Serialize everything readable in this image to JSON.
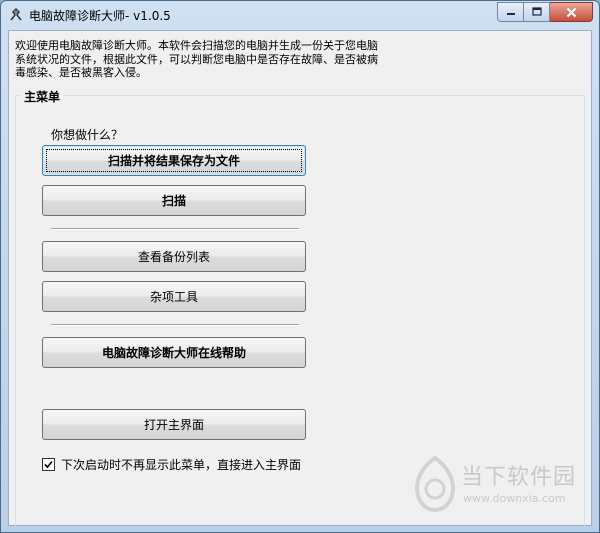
{
  "window": {
    "title": "电脑故障诊断大师- v1.0.5",
    "controls": {
      "minimize": "minimize",
      "maximize": "maximize",
      "close": "close"
    }
  },
  "intro": {
    "text": "欢迎使用电脑故障诊断大师。本软件会扫描您的电脑并生成一份关于您电脑\n系统状况的文件，根据此文件，可以判断您电脑中是否存在故障、是否被病\n毒感染、是否被黑客入侵。"
  },
  "main_menu": {
    "title": "主菜单",
    "prompt": "你想做什么？",
    "buttons": {
      "scan_save": "扫描并将结果保存为文件",
      "scan": "扫描",
      "backup_list": "查看备份列表",
      "misc_tools": "杂项工具",
      "online_help": "电脑故障诊断大师在线帮助",
      "open_main": "打开主界面"
    },
    "checkbox": {
      "label": "下次启动时不再显示此菜单，直接进入主界面",
      "checked": true
    }
  },
  "watermark": {
    "title": "当下软件园",
    "url": "www.downxia.com"
  },
  "colors": {
    "close_button": "#c7503b",
    "title_bar": "#b9d0e8",
    "client_bg": "#f0f0f0"
  }
}
